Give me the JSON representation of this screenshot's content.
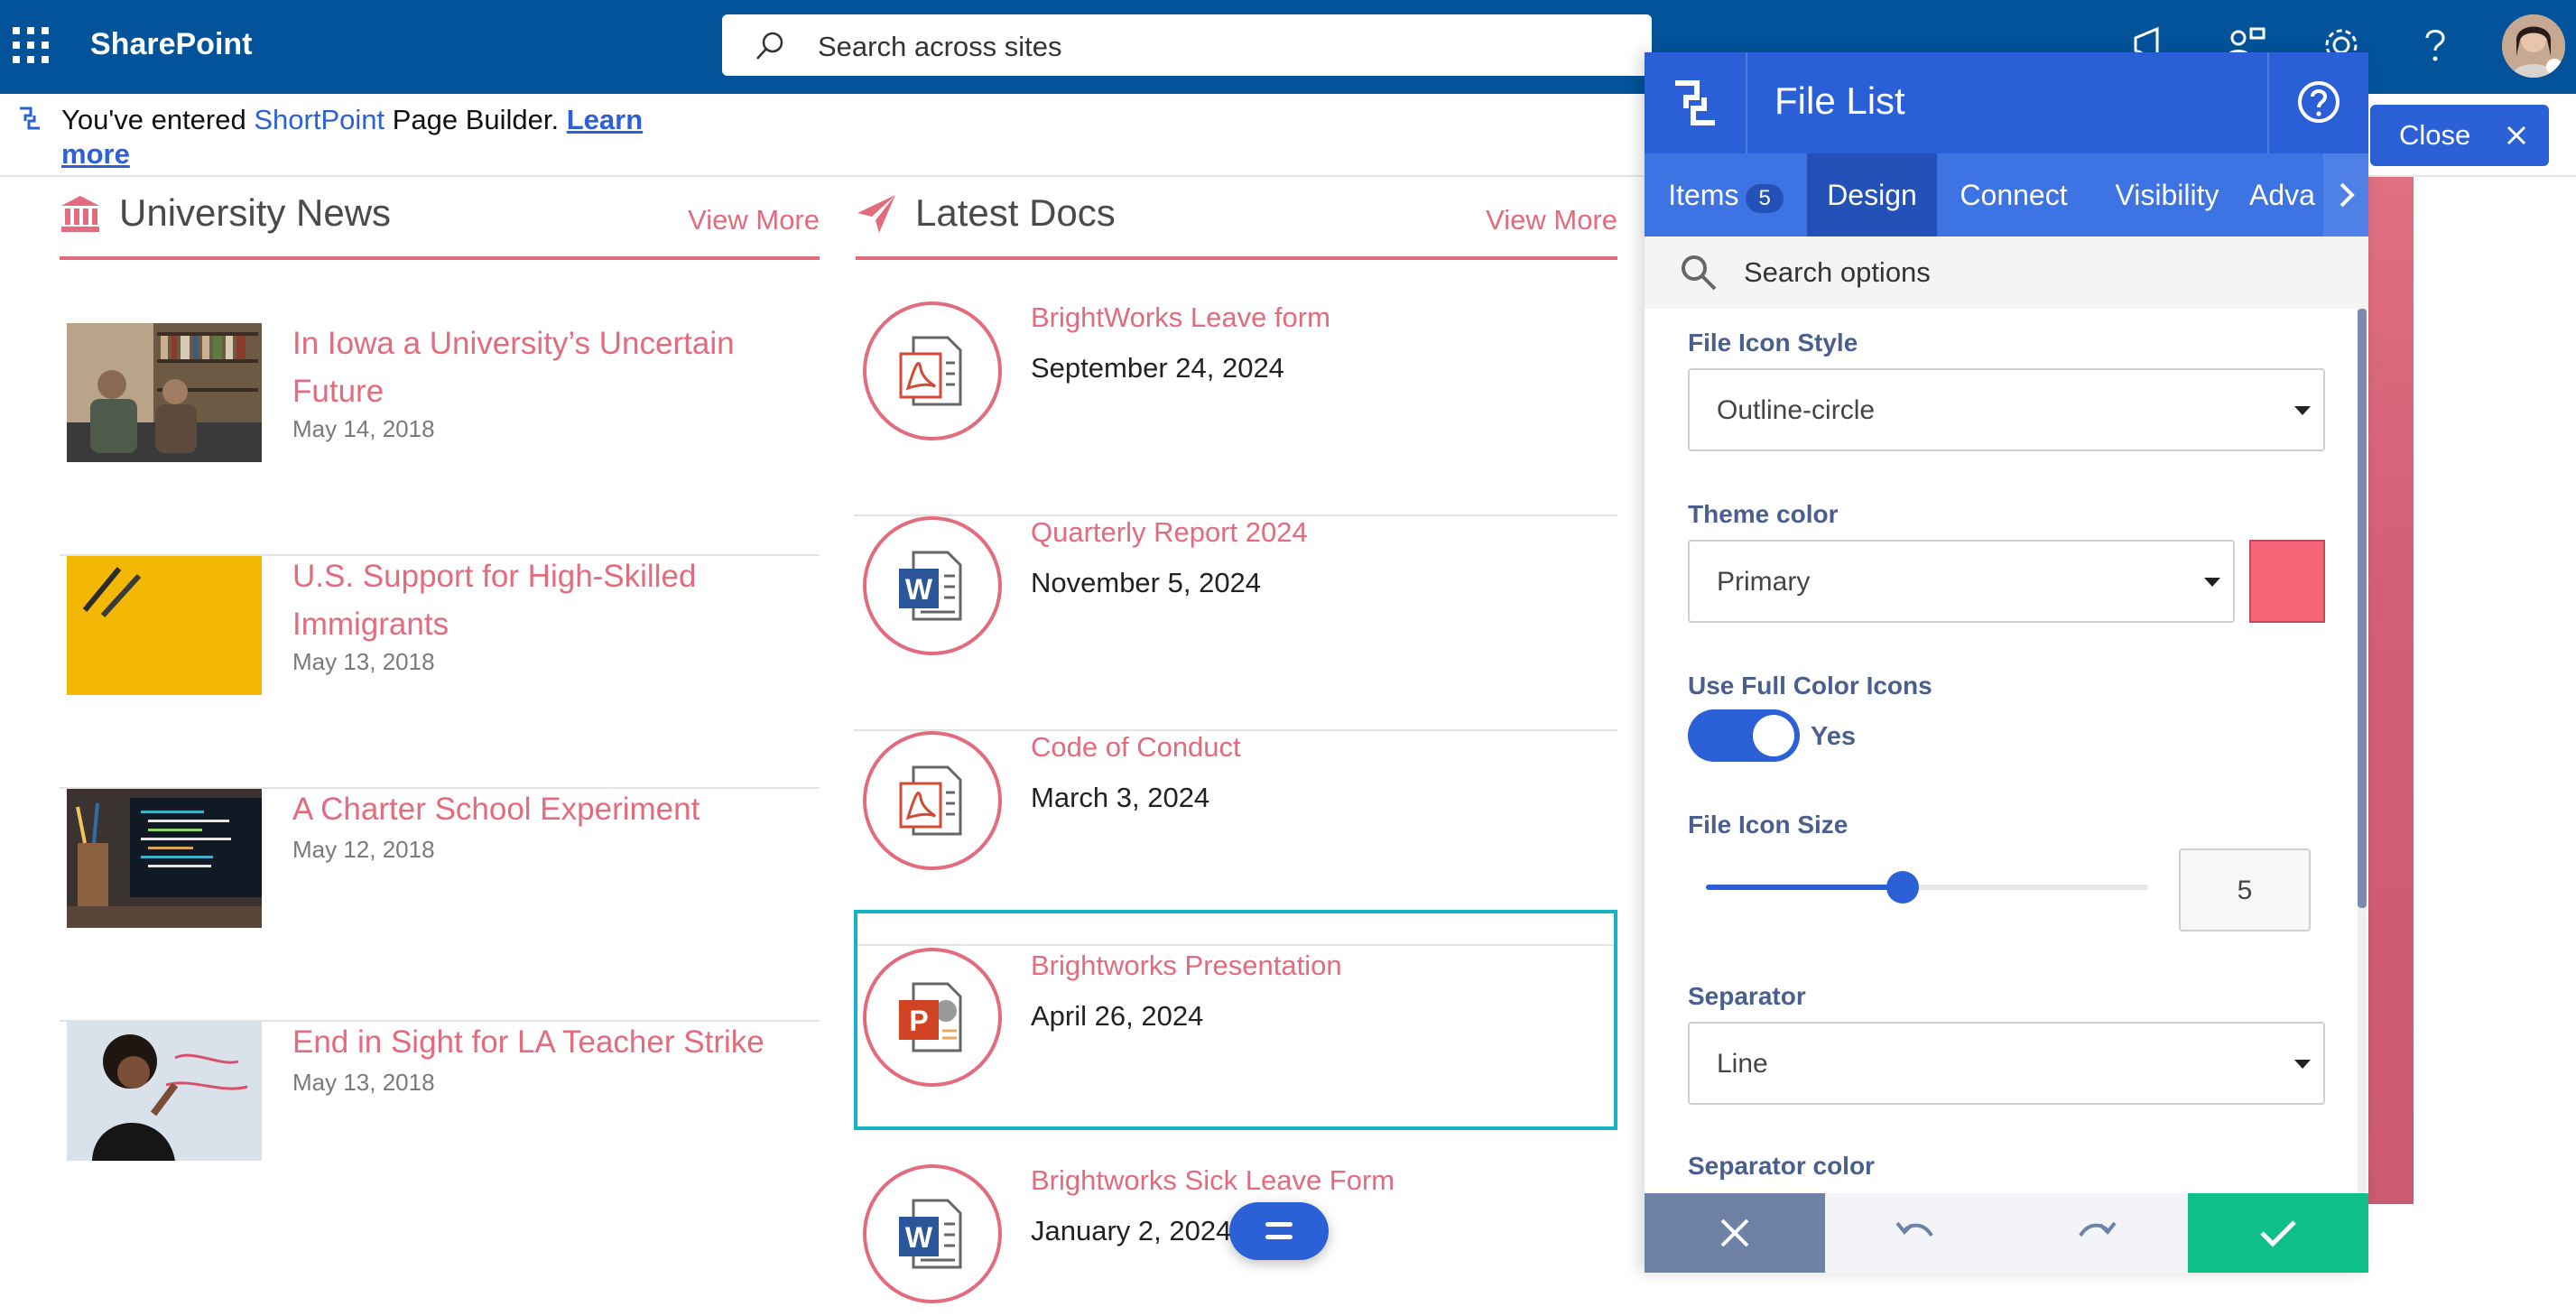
{
  "suitebar": {
    "brand": "SharePoint",
    "search_placeholder": "Search across sites"
  },
  "infobar": {
    "prefix": "You've entered ",
    "product": "ShortPoint",
    "suffix": " Page Builder. ",
    "link": "Learn more"
  },
  "news": {
    "title": "University News",
    "view_more": "View More",
    "items": [
      {
        "title": "In Iowa a University’s Uncertain Future",
        "date": "May 14, 2018"
      },
      {
        "title": "U.S. Support for High-Skilled Immigrants",
        "date": "May 13, 2018"
      },
      {
        "title": "A Charter School Experiment",
        "date": "May 12, 2018"
      },
      {
        "title": "End in Sight for LA Teacher Strike",
        "date": "May 13, 2018"
      }
    ]
  },
  "docs": {
    "title": "Latest Docs",
    "view_more": "View More",
    "items": [
      {
        "title": "BrightWorks Leave form",
        "date": "September 24, 2024",
        "icon": "pdf-icon"
      },
      {
        "title": "Quarterly Report 2024",
        "date": "November 5, 2024",
        "icon": "word-icon"
      },
      {
        "title": "Code of Conduct",
        "date": "March 3, 2024",
        "icon": "pdf-icon"
      },
      {
        "title": "Brightworks Presentation",
        "date": "April 26, 2024",
        "icon": "powerpoint-icon"
      },
      {
        "title": "Brightworks Sick Leave Form",
        "date": "January 2, 2024",
        "icon": "word-icon"
      }
    ]
  },
  "close_label": "Close",
  "panel": {
    "title": "File List",
    "tabs": [
      {
        "label": "Items",
        "badge": "5"
      },
      {
        "label": "Design"
      },
      {
        "label": "Connect"
      },
      {
        "label": "Visibility"
      },
      {
        "label": "Adva"
      }
    ],
    "search_placeholder": "Search options",
    "fields": {
      "icon_style": {
        "label": "File Icon Style",
        "value": "Outline-circle"
      },
      "theme_color": {
        "label": "Theme color",
        "value": "Primary",
        "swatch": "#f46577"
      },
      "full_color": {
        "label": "Use Full Color Icons",
        "value": "Yes"
      },
      "icon_size": {
        "label": "File Icon Size",
        "value": "5"
      },
      "separator": {
        "label": "Separator",
        "value": "Line"
      },
      "separator_color": {
        "label": "Separator color"
      }
    }
  },
  "colors": {
    "suitebar": "#03539b",
    "accent": "#e26b7d",
    "panel_blue": "#2b5fd8",
    "confirm": "#0fbf8a"
  }
}
